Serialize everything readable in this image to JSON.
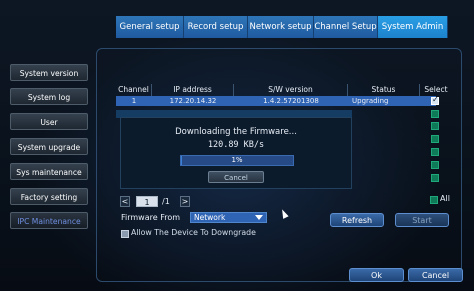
{
  "topmenu": {
    "tabs": [
      {
        "label": "General setup"
      },
      {
        "label": "Record setup"
      },
      {
        "label": "Network setup"
      },
      {
        "label": "Channel Setup"
      },
      {
        "label": "System Admin"
      }
    ]
  },
  "sidebar": {
    "items": [
      {
        "label": "System version"
      },
      {
        "label": "System log"
      },
      {
        "label": "User"
      },
      {
        "label": "System upgrade"
      },
      {
        "label": "Sys maintenance"
      },
      {
        "label": "Factory setting"
      },
      {
        "label": "IPC Maintenance"
      }
    ]
  },
  "table": {
    "headers": [
      "Channel",
      "IP address",
      "S/W version",
      "Status",
      "Select"
    ],
    "rows": [
      {
        "channel": "1",
        "ip": "172.20.14.32",
        "version": "1.4.2.57201308",
        "status": "Upgrading",
        "selected": true
      }
    ]
  },
  "dialog": {
    "title": "Downloading the Firmware...",
    "speed": "120.89 KB/s",
    "progress_label": "1%",
    "progress_value": 0.01,
    "cancel_label": "Cancel"
  },
  "pager": {
    "prev": "<",
    "current": "1",
    "total": "/1",
    "next": ">"
  },
  "select_all_label": "All",
  "firmware": {
    "label": "Firmware From",
    "value": "Network",
    "allow_label": "Allow The Device To Downgrade"
  },
  "buttons": {
    "refresh": "Refresh",
    "start": "Start",
    "ok": "Ok",
    "cancel": "Cancel"
  },
  "colors": {
    "accent": "#2f63b4",
    "tab_active": "#1c82cc",
    "checkbox_green": "#0e7a57"
  }
}
